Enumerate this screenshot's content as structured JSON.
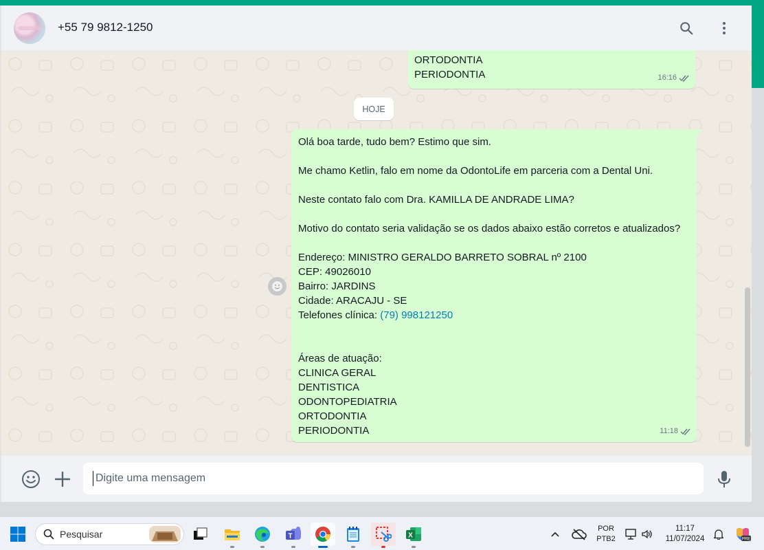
{
  "colors": {
    "accent": "#00a884",
    "bubble_out": "#d9fdd3",
    "chat_bg": "#efeae2",
    "link": "#027eb5",
    "tick": "#667781"
  },
  "header": {
    "contact_name": "+55 79 9812-1250",
    "search_icon": "search-icon",
    "menu_icon": "more-vertical-icon"
  },
  "chat": {
    "prev_message": {
      "lines": [
        "ORTODONTIA",
        "PERIODONTIA"
      ],
      "time": "16:16"
    },
    "day_divider": "HOJE",
    "message": {
      "greeting": "Olá boa tarde, tudo bem? Estimo que sim.",
      "intro": "Me chamo Ketlin, falo em nome da OdontoLife em parceria com a Dental Uni.",
      "question": "Neste contato falo com Dra. KAMILLA DE ANDRADE LIMA?",
      "reason": "Motivo do contato seria validação se os dados abaixo estão corretos e atualizados?",
      "address": "Endereço: MINISTRO GERALDO BARRETO SOBRAL nº 2100",
      "cep": "CEP: 49026010",
      "bairro": "Bairro: JARDINS",
      "cidade": "Cidade: ARACAJU - SE",
      "phone_label": "Telefones clínica: ",
      "phone_link": "(79) 998121250",
      "areas_title": "Áreas de atuação:",
      "areas": [
        "CLINICA GERAL",
        "DENTISTICA",
        "ODONTOPEDIATRIA",
        "ORTODONTIA",
        "PERIODONTIA"
      ],
      "time": "11:18"
    }
  },
  "composer": {
    "placeholder": "Digite uma mensagem",
    "emoji_icon": "emoji-icon",
    "attach_icon": "plus-icon",
    "mic_icon": "microphone-icon"
  },
  "taskbar": {
    "search_label": "Pesquisar",
    "language": "POR",
    "keyboard": "PTB2",
    "time": "11:17",
    "date": "11/07/2024"
  }
}
